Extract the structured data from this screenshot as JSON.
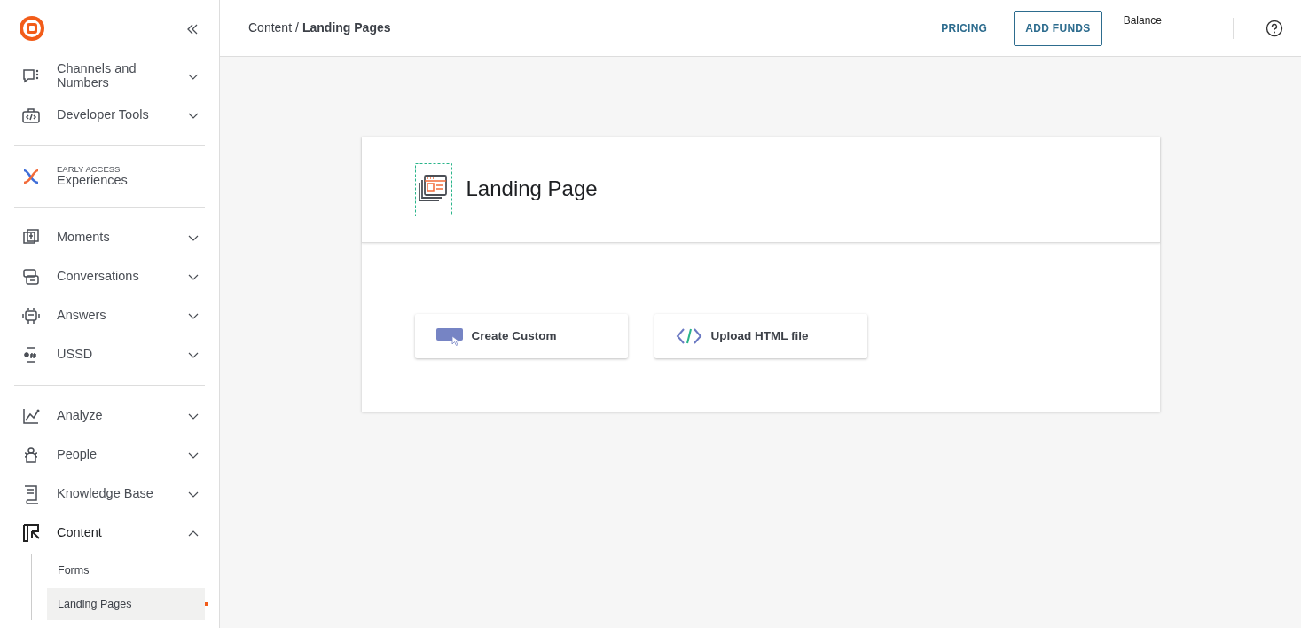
{
  "sidebar": {
    "sections": [
      {
        "items": [
          {
            "label": "Channels and Numbers",
            "expanded": false
          },
          {
            "label": "Developer Tools",
            "expanded": false
          }
        ]
      },
      {
        "early_access": {
          "tag": "EARLY ACCESS",
          "label": "Experiences"
        }
      },
      {
        "items": [
          {
            "label": "Moments",
            "expanded": false
          },
          {
            "label": "Conversations",
            "expanded": false
          },
          {
            "label": "Answers",
            "expanded": false
          },
          {
            "label": "USSD",
            "expanded": false
          }
        ]
      },
      {
        "items": [
          {
            "label": "Analyze",
            "expanded": false
          },
          {
            "label": "People",
            "expanded": false
          },
          {
            "label": "Knowledge Base",
            "expanded": false
          },
          {
            "label": "Content",
            "expanded": true,
            "children": [
              {
                "label": "Forms",
                "selected": false
              },
              {
                "label": "Landing Pages",
                "selected": true
              }
            ]
          }
        ]
      }
    ]
  },
  "header": {
    "breadcrumb": [
      "Content",
      "Landing Pages"
    ],
    "separator": "/",
    "pricing": "PRICING",
    "add_funds": "ADD FUNDS",
    "balance": "Balance"
  },
  "panel": {
    "title": "Landing Page",
    "options": [
      {
        "label": "Create Custom",
        "kind": "custom"
      },
      {
        "label": "Upload HTML file",
        "kind": "html"
      }
    ]
  }
}
